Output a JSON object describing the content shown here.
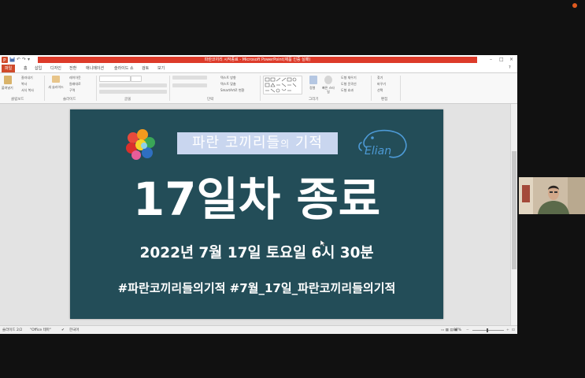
{
  "window": {
    "title": "파란코끼리 시작종료 - Microsoft PowerPoint(제품 인증 실패)"
  },
  "tabs": [
    {
      "label": "파일"
    },
    {
      "label": "홈"
    },
    {
      "label": "삽입"
    },
    {
      "label": "디자인"
    },
    {
      "label": "전환"
    },
    {
      "label": "애니메이션"
    },
    {
      "label": "슬라이드 쇼"
    },
    {
      "label": "검토"
    },
    {
      "label": "보기"
    }
  ],
  "ribbon": {
    "paste_label": "붙여넣기",
    "clipboard_items": [
      "잘라내기",
      "복사",
      "서식 복사"
    ],
    "new_slide_label": "새 슬라이드",
    "slide_items": [
      "레이아웃",
      "원래대로",
      "구역"
    ],
    "paragraph_items": [
      "텍스트 방향",
      "텍스트 맞춤",
      "SmartArt로 변환"
    ],
    "arrange_label": "정렬",
    "quick_styles_label": "빠른 스타일",
    "drawing_items": [
      "도형 채우기",
      "도형 윤곽선",
      "도형 효과"
    ],
    "editing_items": [
      "찾기",
      "바꾸기",
      "선택"
    ],
    "group_names": [
      "클립보드",
      "슬라이드",
      "글꼴",
      "단락",
      "그리기",
      "편집"
    ]
  },
  "slide": {
    "title_main": "파란 코끼리들",
    "title_small": "의",
    "title_end": " 기적",
    "big_text": "17일차 종료",
    "date_line": "2022년 7월 17일 토요일 6시 30분",
    "hashtags": "#파란코끼리들의기적 #7월_17일_파란코끼리들의기적",
    "logo_text": "Elian"
  },
  "status": {
    "slide_count": "슬라이드 2/2",
    "theme": "\"Office 테마\"",
    "language": "한국어",
    "zoom": "87%"
  },
  "colors": {
    "slide_bg": "#234d58",
    "title_banner": "#c9d6ef",
    "titlebar_red": "#dd3b2a",
    "file_tab": "#d04a2b"
  }
}
